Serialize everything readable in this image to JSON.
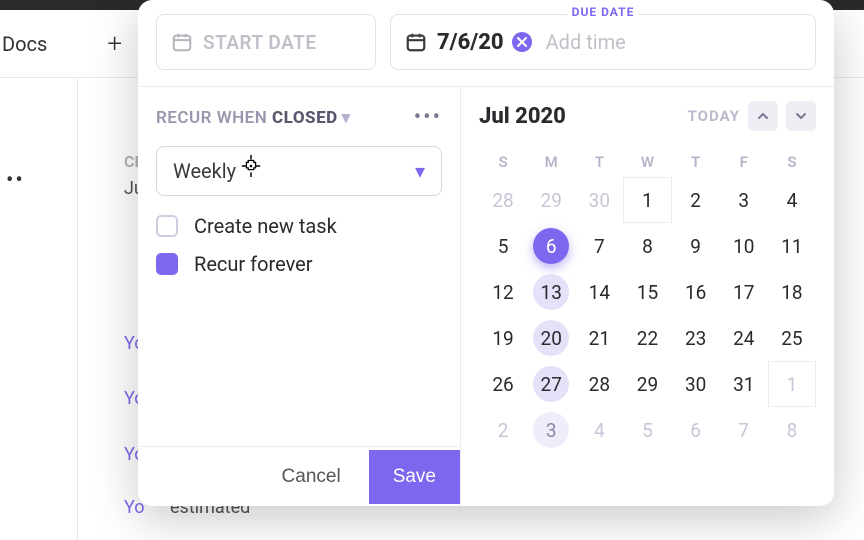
{
  "background": {
    "docs_label": "Docs",
    "plus_label": "+",
    "crumb1": "CR",
    "crumb2": "Ju",
    "link_text": "Yo",
    "estimated": "estimated"
  },
  "date_inputs": {
    "start_placeholder": "START DATE",
    "due_label": "DUE DATE",
    "due_value": "7/6/20",
    "add_time": "Add time"
  },
  "recur": {
    "label_prefix": "RECUR WHEN ",
    "label_state": "CLOSED",
    "dropdown_value": "Weekly",
    "create_new_task": "Create new task",
    "recur_forever": "Recur forever",
    "create_checked": false,
    "forever_checked": true
  },
  "footer": {
    "cancel": "Cancel",
    "save": "Save"
  },
  "calendar": {
    "title": "Jul 2020",
    "today": "TODAY",
    "weekdays": [
      "S",
      "M",
      "T",
      "W",
      "T",
      "F",
      "S"
    ],
    "rows": [
      [
        {
          "d": "28",
          "o": true
        },
        {
          "d": "29",
          "o": true
        },
        {
          "d": "30",
          "o": true
        },
        {
          "d": "1",
          "box": true
        },
        {
          "d": "2"
        },
        {
          "d": "3"
        },
        {
          "d": "4"
        }
      ],
      [
        {
          "d": "5"
        },
        {
          "d": "6",
          "sel": true
        },
        {
          "d": "7"
        },
        {
          "d": "8"
        },
        {
          "d": "9"
        },
        {
          "d": "10"
        },
        {
          "d": "11"
        }
      ],
      [
        {
          "d": "12"
        },
        {
          "d": "13",
          "hl": true
        },
        {
          "d": "14"
        },
        {
          "d": "15"
        },
        {
          "d": "16"
        },
        {
          "d": "17"
        },
        {
          "d": "18"
        }
      ],
      [
        {
          "d": "19"
        },
        {
          "d": "20",
          "hl": true
        },
        {
          "d": "21"
        },
        {
          "d": "22"
        },
        {
          "d": "23"
        },
        {
          "d": "24"
        },
        {
          "d": "25"
        }
      ],
      [
        {
          "d": "26"
        },
        {
          "d": "27",
          "hl": true
        },
        {
          "d": "28"
        },
        {
          "d": "29"
        },
        {
          "d": "30"
        },
        {
          "d": "31"
        },
        {
          "d": "1",
          "o": true,
          "box": true
        }
      ],
      [
        {
          "d": "2",
          "o": true
        },
        {
          "d": "3",
          "fade": true,
          "o": true
        },
        {
          "d": "4",
          "o": true
        },
        {
          "d": "5",
          "o": true
        },
        {
          "d": "6",
          "o": true
        },
        {
          "d": "7",
          "o": true
        },
        {
          "d": "8",
          "o": true
        }
      ]
    ]
  }
}
